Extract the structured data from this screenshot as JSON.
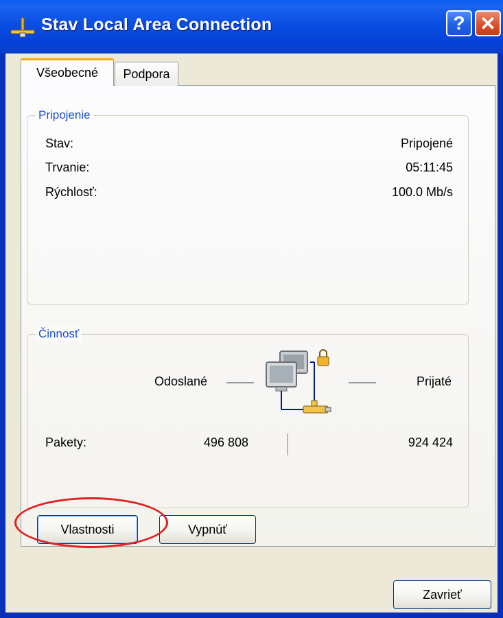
{
  "window": {
    "title": "Stav Local Area Connection",
    "help_label": "?",
    "close_label": "✕",
    "icon": "network-connection-icon"
  },
  "tabs": [
    {
      "label": "Všeobecné",
      "active": true
    },
    {
      "label": "Podpora",
      "active": false
    }
  ],
  "connection": {
    "legend": "Pripojenie",
    "rows": [
      {
        "label": "Stav:",
        "value": "Pripojené"
      },
      {
        "label": "Trvanie:",
        "value": "05:11:45"
      },
      {
        "label": "Rýchlosť:",
        "value": "100.0 Mb/s"
      }
    ]
  },
  "activity": {
    "legend": "Činnosť",
    "sent_label": "Odoslané",
    "received_label": "Prijaté",
    "packets_label": "Pakety:",
    "packets_sent": "496 808",
    "packets_received": "924 424",
    "icon": "network-computers-icon"
  },
  "buttons": {
    "properties": "Vlastnosti",
    "disable": "Vypnúť",
    "close": "Zavrieť"
  },
  "colors": {
    "titlebar": "#0a4ee2",
    "legend_text": "#1a4ed1",
    "highlight": "#e21f1f",
    "tab_accent": "#f5a800"
  }
}
